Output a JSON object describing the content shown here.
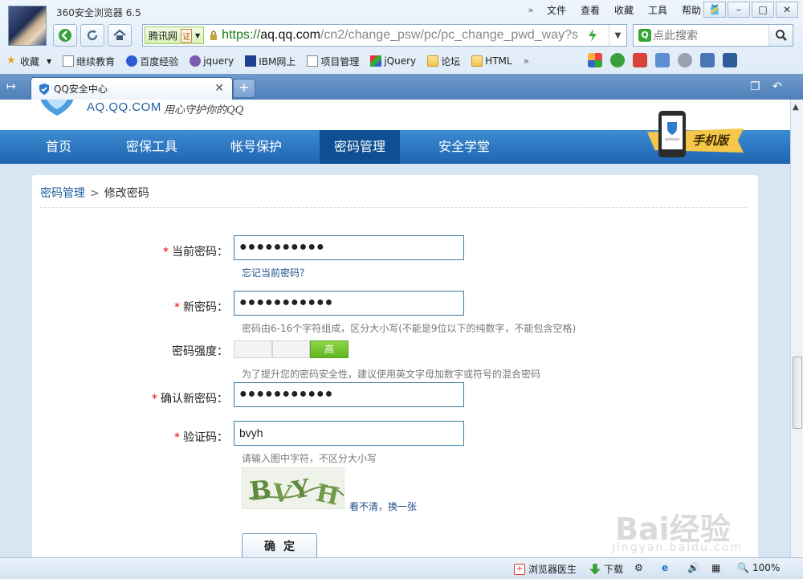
{
  "window": {
    "title": "360安全浏览器 6.5",
    "menu": [
      "文件",
      "查看",
      "收藏",
      "工具",
      "帮助"
    ],
    "controls": [
      "🎽",
      "–",
      "□",
      "✕"
    ]
  },
  "address_bar": {
    "site_name": "腾讯网",
    "cert_label": "证",
    "url_scheme": "https://",
    "url_host": "aq.qq.com",
    "url_path": "/cn2/change_psw/pc/pc_change_pwd_way?s"
  },
  "search": {
    "placeholder": "点此搜索"
  },
  "bookmarks": [
    "收藏",
    "继续教育",
    "百度经验",
    "jquery",
    "IBM网上",
    "项目管理",
    "jQuery",
    "论坛",
    "HTML"
  ],
  "tab": {
    "label": "QQ安全中心"
  },
  "site": {
    "logo_text": "AQ.QQ.COM",
    "slogan": "用心守护你的QQ",
    "nav": [
      "首页",
      "密保工具",
      "帐号保护",
      "密码管理",
      "安全学堂"
    ],
    "active_nav": "密码管理",
    "mobile_label": "手机版"
  },
  "breadcrumb": {
    "parent": "密码管理",
    "separator": ">",
    "current": "修改密码"
  },
  "form": {
    "required_mark": "*",
    "current_password": {
      "label": "当前密码：",
      "value": "●●●●●●●●●●",
      "forgot_link": "忘记当前密码？"
    },
    "new_password": {
      "label": "新密码：",
      "value": "●●●●●●●●●●●",
      "hint": "密码由6-16个字符组成，区分大小写(不能是9位以下的纯数字，不能包含空格)"
    },
    "strength": {
      "label": "密码强度：",
      "level_text": "高",
      "level": 3,
      "max": 3,
      "hint": "为了提升您的密码安全性，建议使用英文字母加数字或符号的混合密码"
    },
    "confirm_password": {
      "label": "确认新密码：",
      "value": "●●●●●●●●●●●"
    },
    "captcha": {
      "label": "验证码：",
      "value": "bvyh",
      "hint": "请输入图中字符，不区分大小写",
      "refresh_link": "看不清，换一张"
    },
    "submit_label": "确定"
  },
  "status_bar": {
    "doctor": "浏览器医生",
    "download": "下载",
    "zoom": "100%"
  },
  "watermark": {
    "brand": "Bai经验",
    "domain": "jingyan.baidu.com"
  },
  "colors": {
    "nav_blue": "#1f65b0",
    "nav_active": "#0f4f93",
    "link": "#1e4e8a",
    "required": "#e00000",
    "strength_high": "#5fb720"
  }
}
